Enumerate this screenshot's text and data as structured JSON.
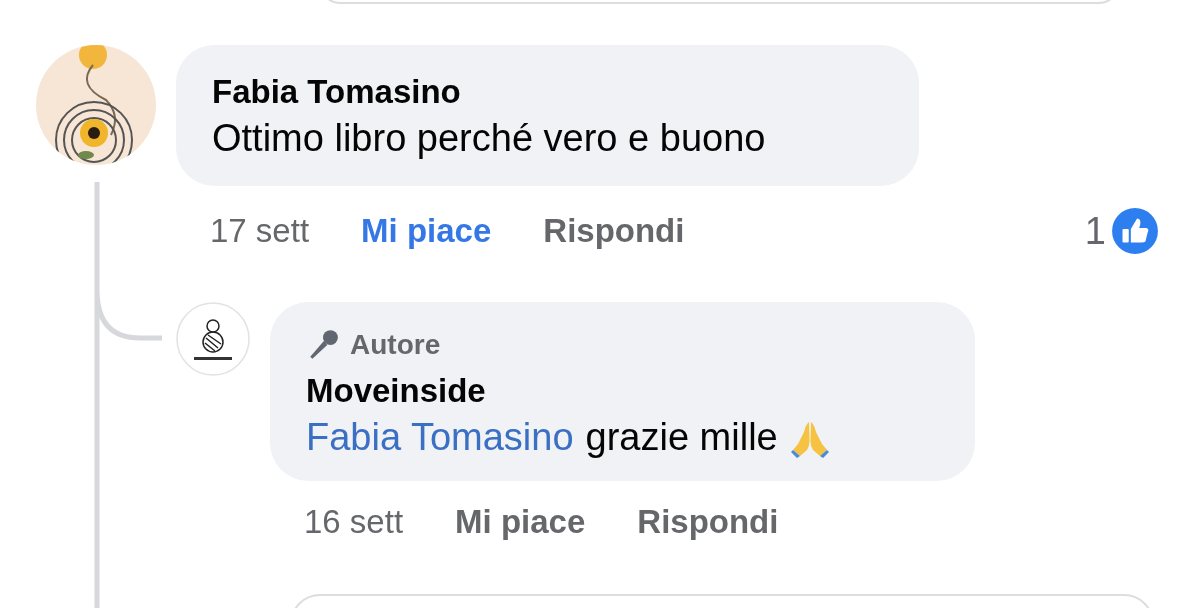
{
  "comments": [
    {
      "author": "Fabia Tomasino",
      "text": "Ottimo libro perché vero e buono",
      "time": "17 sett",
      "like_label": "Mi piace",
      "liked": true,
      "reply_label": "Rispondi",
      "reaction_count": "1"
    },
    {
      "author": "Moveinside",
      "badge": "Autore",
      "mention": "Fabia Tomasino",
      "text": "grazie mille",
      "praying_emoji": true,
      "time": "16 sett",
      "like_label": "Mi piace",
      "liked": false,
      "reply_label": "Rispondi"
    }
  ]
}
